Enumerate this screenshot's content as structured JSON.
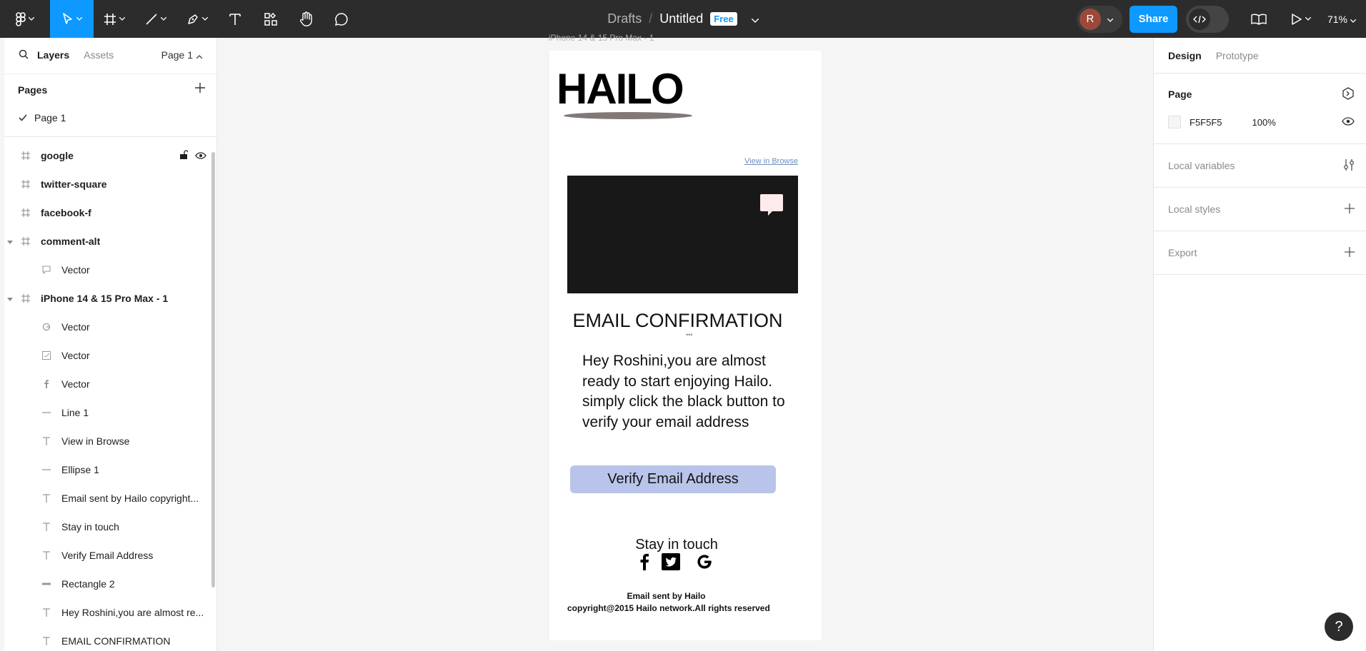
{
  "toolbar": {
    "breadcrumb_drafts": "Drafts",
    "breadcrumb_sep": "/",
    "file_name": "Untitled",
    "plan_badge": "Free",
    "avatar_initial": "R",
    "share_label": "Share",
    "zoom": "71%"
  },
  "left_panel": {
    "tab_layers": "Layers",
    "tab_assets": "Assets",
    "page_selector": "Page 1",
    "pages_heading": "Pages",
    "pages": [
      {
        "label": "Page 1"
      }
    ],
    "layers": [
      {
        "name": "google",
        "level": "top",
        "icon": "frame-icon"
      },
      {
        "name": "twitter-square",
        "level": "top",
        "icon": "frame-icon"
      },
      {
        "name": "facebook-f",
        "level": "top",
        "icon": "frame-icon"
      },
      {
        "name": "comment-alt",
        "level": "top",
        "icon": "frame-icon",
        "expanded": true
      },
      {
        "name": "Vector",
        "level": "child",
        "icon": "vector-comment-icon"
      },
      {
        "name": "iPhone 14 & 15 Pro Max - 1",
        "level": "top",
        "icon": "frame-icon",
        "expanded": true
      },
      {
        "name": "Vector",
        "level": "child",
        "icon": "vector-google-icon"
      },
      {
        "name": "Vector",
        "level": "child",
        "icon": "vector-twitter-icon"
      },
      {
        "name": "Vector",
        "level": "child",
        "icon": "vector-facebook-icon"
      },
      {
        "name": "Line 1",
        "level": "child",
        "icon": "line-icon"
      },
      {
        "name": "View in Browse",
        "level": "child",
        "icon": "text-icon"
      },
      {
        "name": "Ellipse 1",
        "level": "child",
        "icon": "line-icon"
      },
      {
        "name": "Email sent by Hailo copyright...",
        "level": "child",
        "icon": "text-icon"
      },
      {
        "name": "Stay in touch",
        "level": "child",
        "icon": "text-icon"
      },
      {
        "name": "Verify Email Address",
        "level": "child",
        "icon": "text-icon"
      },
      {
        "name": "Rectangle 2",
        "level": "child",
        "icon": "rectangle-icon"
      },
      {
        "name": "Hey Roshini,you are almost re...",
        "level": "child",
        "icon": "text-icon"
      },
      {
        "name": "EMAIL CONFIRMATION",
        "level": "child",
        "icon": "text-icon"
      }
    ]
  },
  "canvas": {
    "frame_label": "iPhone 14 & 15 Pro Max - 1",
    "logo_text": "HAILO",
    "view_in_browser": "View in Browse",
    "heading": "EMAIL CONFIRMATION",
    "heading_dots": "•••",
    "body_text": "Hey Roshini,you are almost ready to start enjoying Hailo. simply click the black button to verify your email address",
    "cta_label": "Verify Email Address",
    "stay_in_touch": "Stay in touch",
    "footer_line1": "Email sent by Hailo",
    "footer_line2": "copyright@2015 Hailo network.All rights reserved",
    "colors": {
      "hero": "#181818",
      "cta": "#b9c4ea",
      "ellipse": "#827878",
      "link": "#6e8fbf"
    }
  },
  "right_panel": {
    "tab_design": "Design",
    "tab_prototype": "Prototype",
    "page_heading": "Page",
    "page_color_hex": "F5F5F5",
    "page_color_opacity": "100%",
    "local_variables": "Local variables",
    "local_styles": "Local styles",
    "export": "Export",
    "help": "?"
  },
  "theme": {
    "toolbar_bg": "#2c2c2c",
    "accent": "#0d99ff",
    "canvas_bg": "#f5f5f5"
  }
}
